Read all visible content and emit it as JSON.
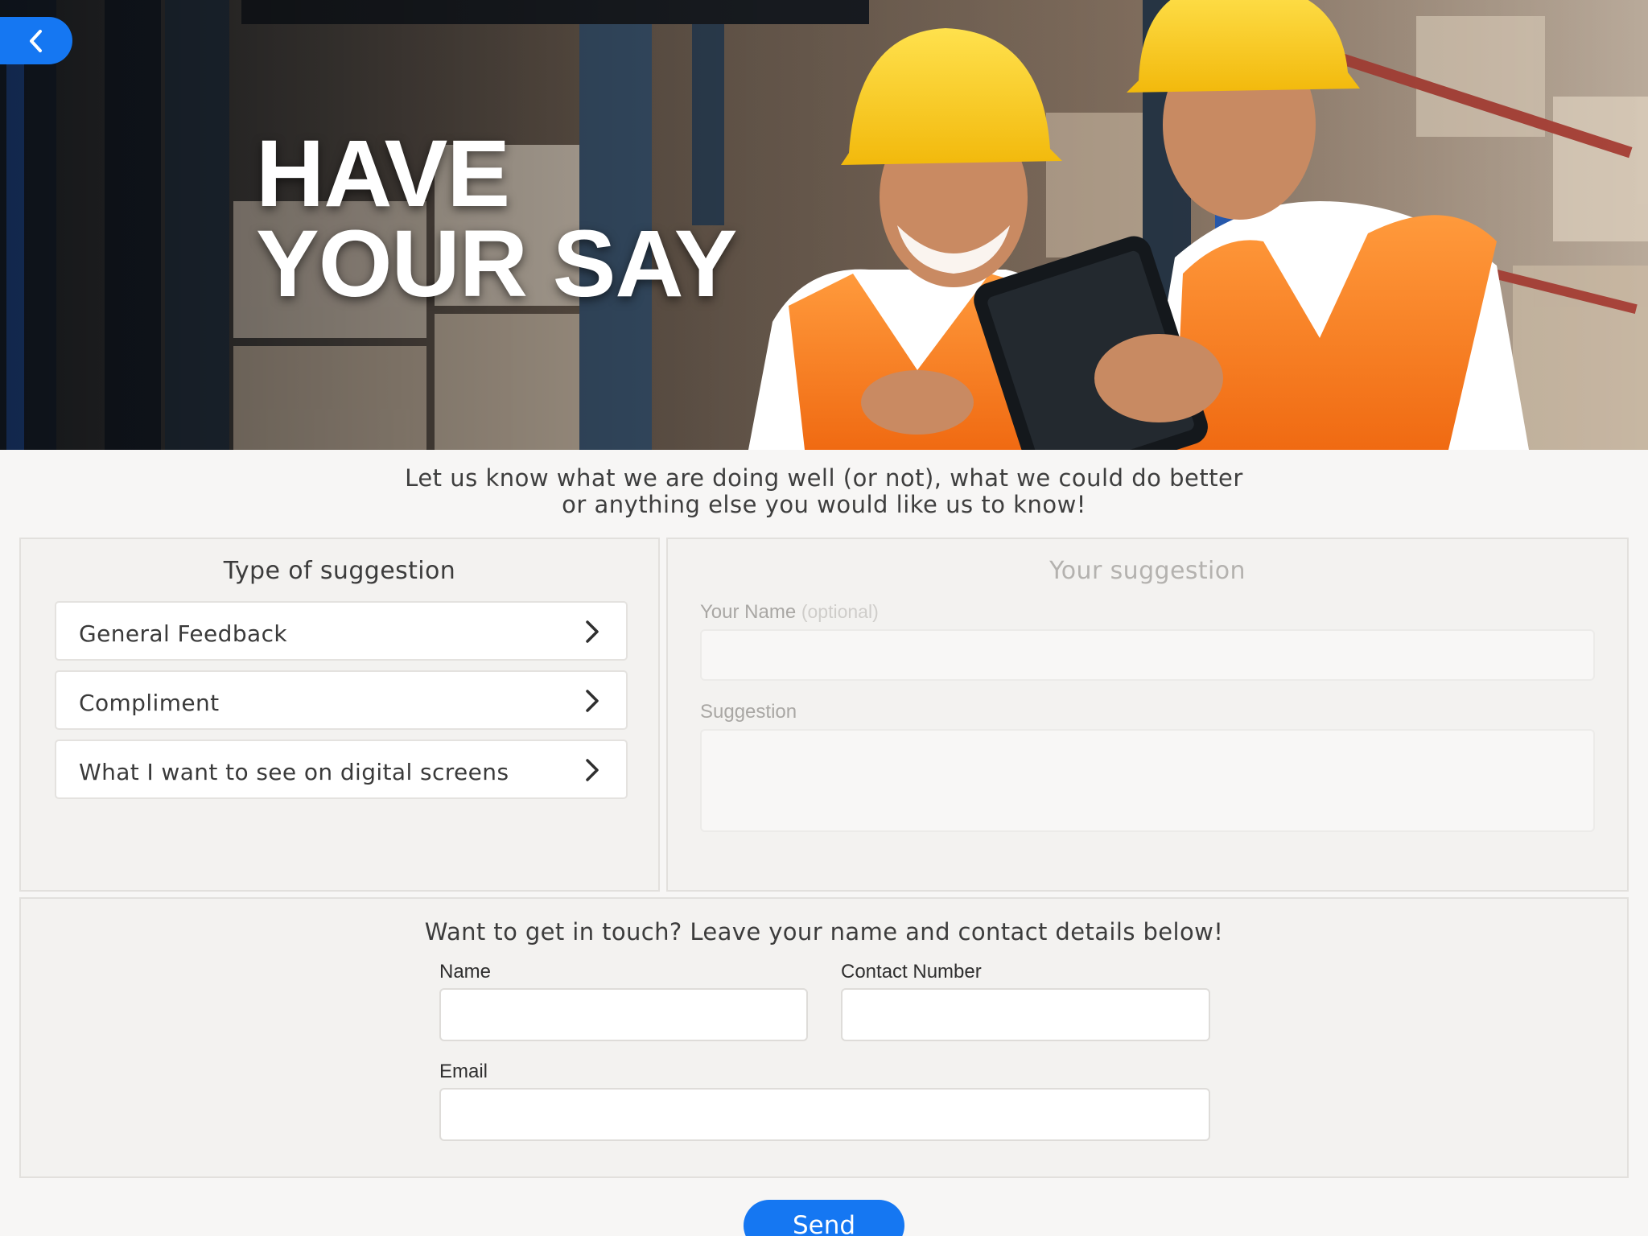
{
  "hero": {
    "title_line1": "HAVE",
    "title_line2": "YOUR SAY"
  },
  "back_icon": "chevron-left-icon",
  "intro": {
    "line1": "Let us know what we are doing well (or not), what we could do better",
    "line2": "or anything else you would like us to know!"
  },
  "type_panel": {
    "heading": "Type of suggestion",
    "items": [
      {
        "label": "General Feedback",
        "icon": "chevron-right-icon"
      },
      {
        "label": "Compliment",
        "icon": "chevron-right-icon"
      },
      {
        "label": "What I want to see on digital screens",
        "icon": "chevron-right-icon"
      }
    ]
  },
  "suggest_panel": {
    "heading": "Your suggestion",
    "name_label": "Your Name",
    "name_optional": "(optional)",
    "name_value": "",
    "suggestion_label": "Suggestion",
    "suggestion_value": ""
  },
  "contact_panel": {
    "heading": "Want to get in touch? Leave your name and contact details below!",
    "name_label": "Name",
    "name_value": "",
    "phone_label": "Contact Number",
    "phone_value": "",
    "email_label": "Email",
    "email_value": ""
  },
  "send_label": "Send",
  "colors": {
    "accent": "#1577f2",
    "page_bg": "#f7f6f5",
    "panel_bg": "#f3f2f0"
  }
}
